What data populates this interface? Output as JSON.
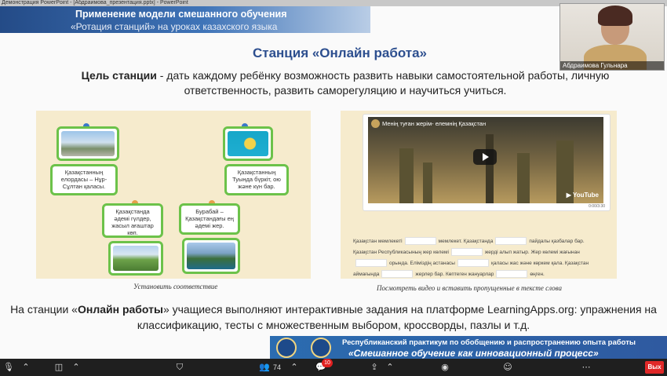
{
  "window": {
    "title": "Демонстрация PowerPoint - [Абдраимова_презентация.pptx] - PowerPoint"
  },
  "slide": {
    "banner_line1": "Применение модели смешанного обучения",
    "banner_line2": "«Ротация станций» на уроках казахского языка",
    "title": "Станция «Онлайн работа»",
    "goal_bold": "Цель станции",
    "goal_text": " - дать каждому ребёнку возможность развить навыки самостоятельной работы, личную ответственность, развить саморегуляцию и научиться учиться.",
    "left_panel": {
      "cards": [
        "Қазақстанның елордасы – Нұр-Сұлтан қаласы.",
        "Қазақстанның Туында бүркіт, ою және күн бар.",
        "Қазақстанда әдемі гүлдер, жасыл ағаштар көп.",
        "Бурабай – Қазақстандағы ең әдемі жер."
      ],
      "caption": "Установить соответствие"
    },
    "right_panel": {
      "video_title": "Менің туған жерім- елемнің Қазақстан",
      "video_brand": "▶ YouTube",
      "video_time": "0:00/3:30",
      "fill_lines": [
        [
          "Қазақстан мемлекеті",
          "мемлекет. Қазақстанда",
          "пайдалы қазбалар бар."
        ],
        [
          "Қазақстан Республикасының жер көлемі",
          "жерді алып жатыр. Жер көлемі жағынан"
        ],
        [
          "",
          "орында. Еліміздің астанасы",
          "қаласы жас және көркем қала. Қазақстан"
        ],
        [
          "аймағында",
          "жерлер бар. Көптеген жануарлар",
          "өңген."
        ]
      ],
      "caption": "Посмотреть видео и вставить пропущенные в тексте  слова"
    },
    "bottom_text_prefix": "На станции «",
    "bottom_text_bold": "Онлайн работы",
    "bottom_text_suffix": "» учащиеся выполняют интерактивные задания на платформе LearningApps.org: упражнения на классификацию, тесты с множественным выбором, кроссворды, пазлы и т.д.",
    "footer_line1": "Республиканский практикум по обобщению и распространению опыта работы",
    "footer_line2": "«Смешанное обучение как инновационный процесс»"
  },
  "webcam": {
    "name": "Абдраимова Гульнара"
  },
  "toolbar": {
    "participants_count": "74",
    "chat_badge": "10",
    "end_label": "Вых"
  },
  "colors": {
    "accent": "#2d4f8f",
    "card_border": "#6cc24a",
    "panel_bg": "#f6ebcd",
    "end": "#e02828"
  }
}
